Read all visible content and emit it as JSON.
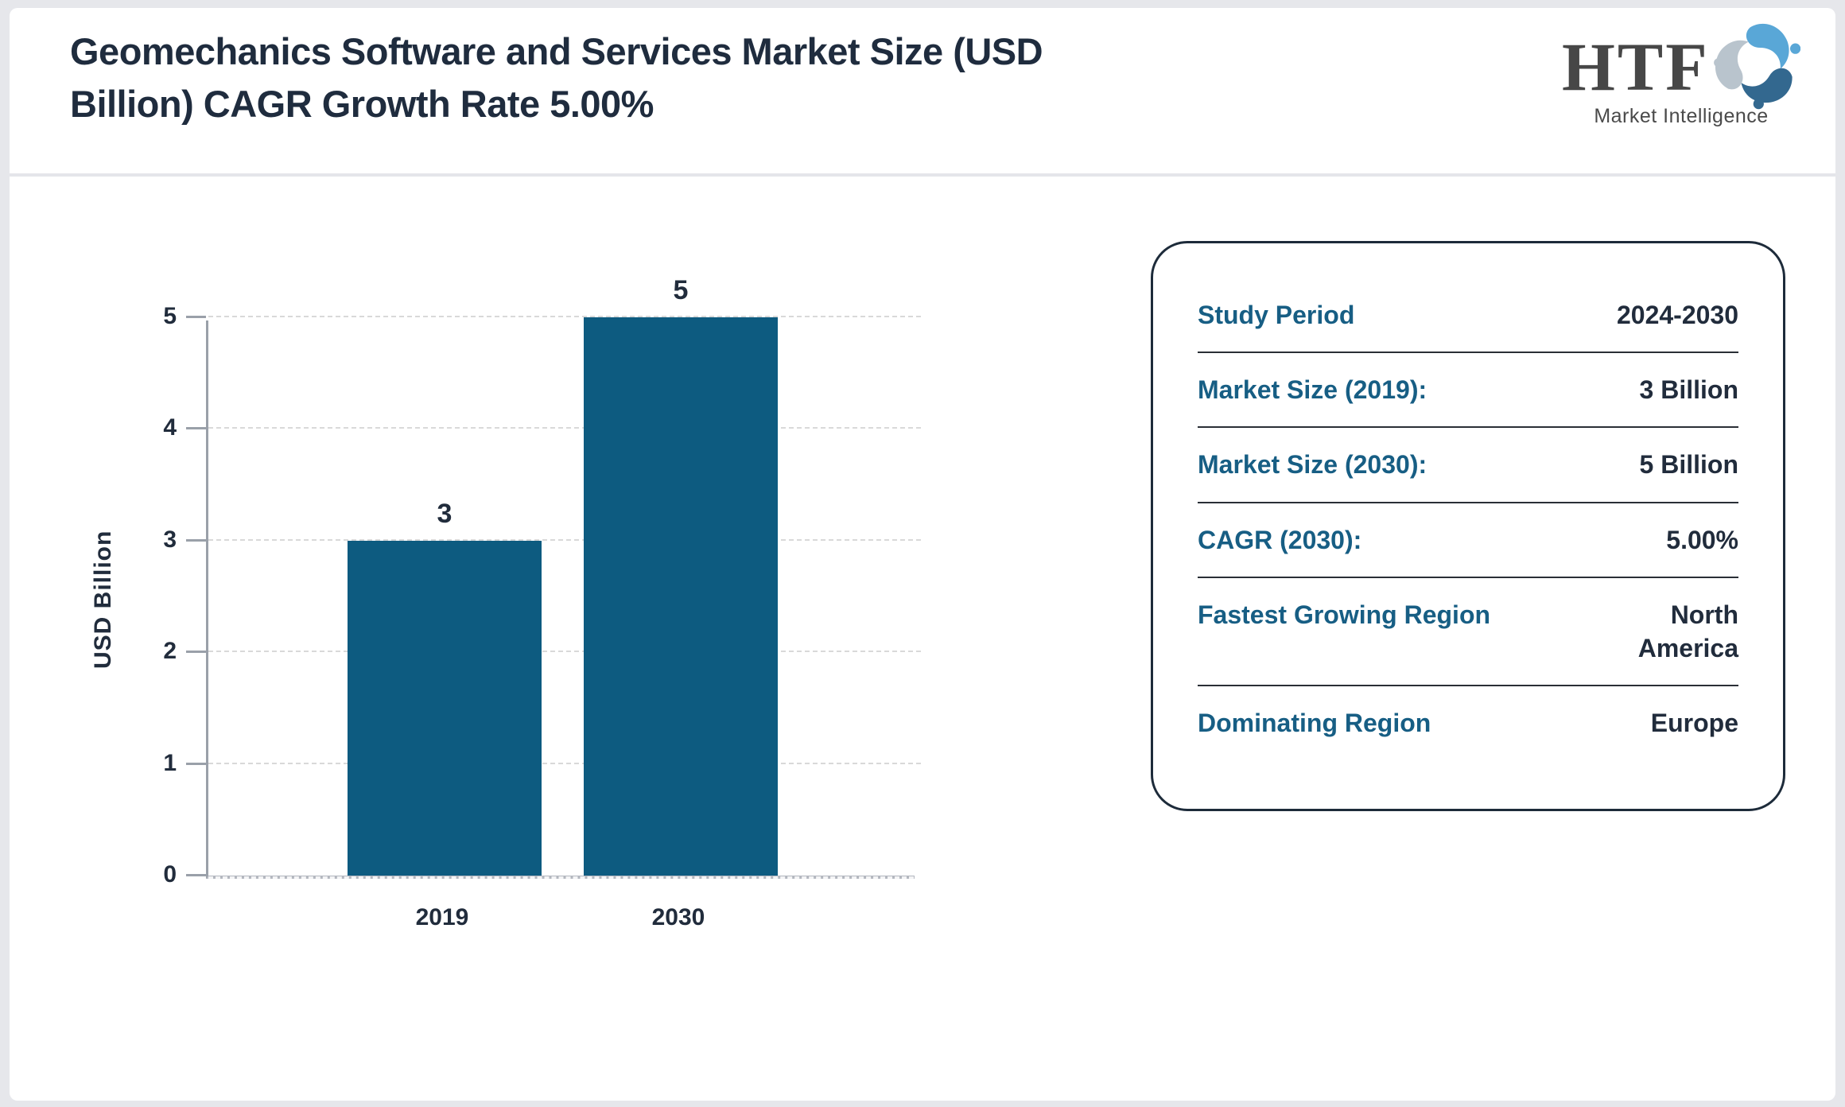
{
  "header": {
    "title": "Geomechanics Software and Services Market Size (USD Billion) CAGR Growth Rate 5.00%",
    "logo": {
      "brand": "HTF",
      "tagline": "Market Intelligence",
      "icon": "htf-swirl-logo-icon"
    }
  },
  "chart_data": {
    "type": "bar",
    "title": "",
    "categories": [
      "2019",
      "2030"
    ],
    "values": [
      3,
      5
    ],
    "xlabel": "",
    "ylabel": "USD Billion",
    "ylim": [
      0,
      5
    ],
    "yticks": [
      0,
      1,
      2,
      3,
      4,
      5
    ],
    "grid": "horizontal-dashed",
    "legend": "none",
    "bar_color": "#0d5b80"
  },
  "info_panel": {
    "rows": [
      {
        "label": "Study Period",
        "value": "2024-2030"
      },
      {
        "label": "Market Size (2019):",
        "value": "3 Billion"
      },
      {
        "label": "Market Size (2030):",
        "value": "5 Billion"
      },
      {
        "label": "CAGR (2030):",
        "value": "5.00%"
      },
      {
        "label": "Fastest Growing Region",
        "value": "North America"
      },
      {
        "label": "Dominating Region",
        "value": "Europe"
      }
    ]
  },
  "colors": {
    "page_bg": "#e6e7eb",
    "bar": "#0d5b80",
    "accent_label": "#175e84",
    "text_dark": "#212c3c",
    "title": "#1f2c3e",
    "axis": "#9aa0a9",
    "baseline": "#b3b7bf",
    "grid": "#d9d9d9",
    "panel_border": "#1d2b3a",
    "divider": "#2a2f36",
    "header_divider": "#e4e5ea",
    "logo_text": "#474747",
    "logo_blue": "#59a7d7",
    "logo_dark_blue": "#33688f",
    "logo_gray": "#b9c4cd"
  }
}
